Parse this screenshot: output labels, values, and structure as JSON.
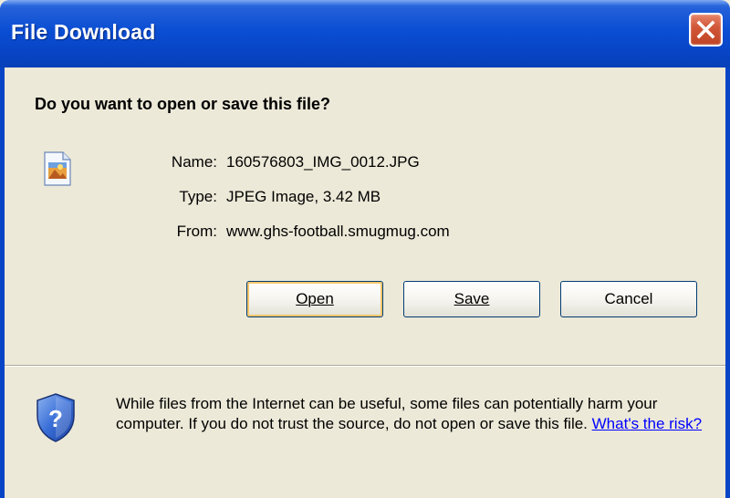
{
  "window": {
    "title": "File Download",
    "close_label": "close"
  },
  "dialog": {
    "question": "Do you want to open or save this file?",
    "file": {
      "name_label": "Name:",
      "name_value": "160576803_IMG_0012.JPG",
      "type_label": "Type:",
      "type_value": "JPEG Image, 3.42 MB",
      "from_label": "From:",
      "from_value": "www.ghs-football.smugmug.com"
    },
    "buttons": {
      "open_label": "Open",
      "save_label": "Save",
      "cancel_label": "Cancel"
    },
    "warning": {
      "text": "While files from the Internet can be useful, some files can potentially harm your computer. If you do not trust the source, do not open or save this file.",
      "link_text": "What's the risk?"
    }
  },
  "colors": {
    "title_bar": "#0845c6",
    "close_button": "#d2583a",
    "dialog_background": "#ece9d8",
    "link": "#0000ff",
    "default_button_focus": "#f6c66a"
  },
  "icons": {
    "file": "jpeg-file-icon",
    "shield": "security-shield-question-icon",
    "close": "close-x-icon"
  }
}
